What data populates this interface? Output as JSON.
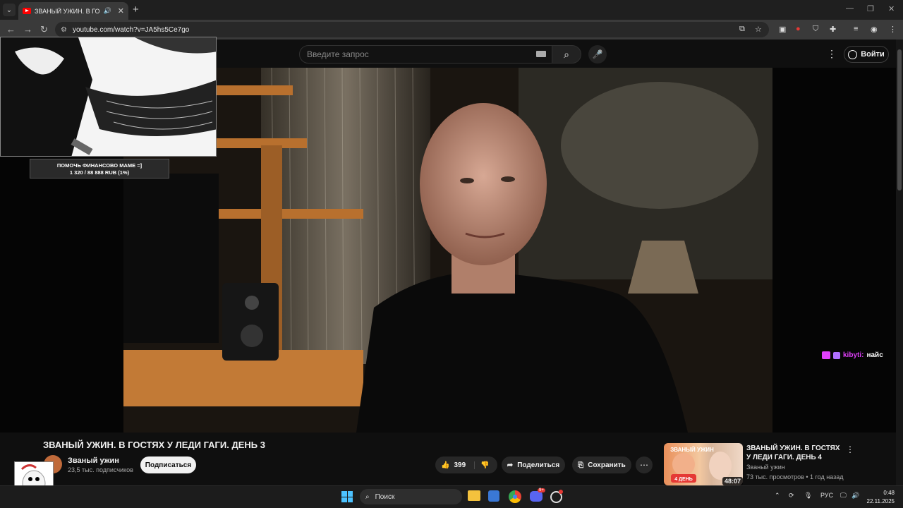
{
  "browser": {
    "tab_title": "ЗВАНЫЙ УЖИН. В ГОСТЯХ",
    "url": "youtube.com/watch?v=JA5hs5Ce7go"
  },
  "youtube": {
    "search_placeholder": "Введите запрос",
    "signin_label": "Войти"
  },
  "overlay": {
    "donation_line1": "ПОМОЧЬ ФИНАНСОВО МАМЕ =]",
    "donation_line2": "1 320 / 88 888 RUB (1%)",
    "donation_progress": 0.01,
    "chat_user": "kibyti:",
    "chat_message": "найс",
    "chat_user_color": "#e040fb"
  },
  "video": {
    "title": "ЗВАНЫЙ УЖИН. В ГОСТЯХ У ЛЕДИ ГАГИ. ДЕНЬ 3",
    "channel": "Званый ужин",
    "subscribers": "23,5 тыс. подписчиков",
    "subscribe_label": "Подписаться",
    "likes": "399",
    "share_label": "Поделиться",
    "save_label": "Сохранить"
  },
  "recommendation": {
    "title": "ЗВАНЫЙ УЖИН. В ГОСТЯХ У ЛЕДИ ГАГИ. ДЕНЬ 4",
    "channel": "Званый ужин",
    "meta": "73 тыс. просмотров • 1 год назад",
    "duration": "48:07",
    "thumb_badge": "4 ДЕНЬ",
    "thumb_logo": "ЗВАНЫЙ УЖИН"
  },
  "taskbar": {
    "search_label": "Поиск",
    "language": "РУС",
    "time": "0:48",
    "date": "22.11.2025",
    "discord_badge": "9+"
  },
  "colors": {
    "accent_red": "#ff0000",
    "background": "#0f0f0f"
  }
}
